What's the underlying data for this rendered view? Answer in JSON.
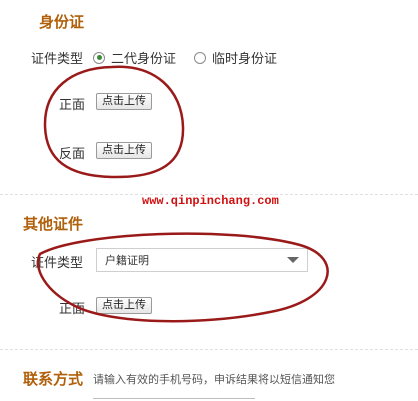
{
  "id_section": {
    "title": "身份证",
    "doc_type_label": "证件类型",
    "radio_options": [
      {
        "label": "二代身份证",
        "selected": true
      },
      {
        "label": "临时身份证",
        "selected": false
      }
    ],
    "front_label": "正面",
    "back_label": "反面",
    "upload_label": "点击上传"
  },
  "watermark": "www.qinpinchang.com",
  "other_section": {
    "title": "其他证件",
    "doc_type_label": "证件类型",
    "select_value": "户籍证明",
    "front_label": "正面",
    "upload_label": "点击上传"
  },
  "contact_section": {
    "title": "联系方式",
    "hint": "请输入有效的手机号码，申诉结果将以短信通知您"
  },
  "colors": {
    "section_title": "#b0600a",
    "annotation_ellipse": "#9a1a1a",
    "watermark": "#d01010",
    "radio_selected": "#3a8a3a"
  },
  "icons": [
    "radio-selected-icon",
    "radio-unselected-icon",
    "dropdown-arrow-icon"
  ]
}
